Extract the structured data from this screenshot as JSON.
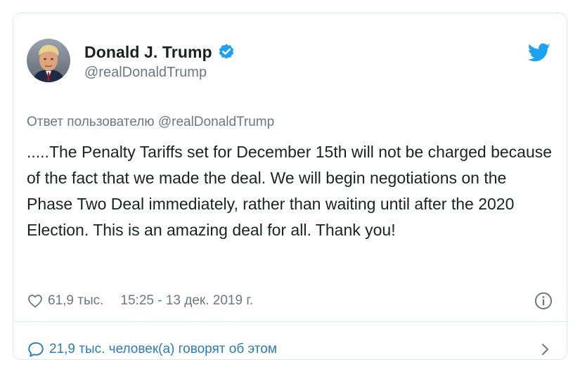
{
  "author": {
    "name": "Donald J. Trump",
    "handle": "@realDonaldTrump",
    "verified": true
  },
  "reply_to": "Ответ пользователю @realDonaldTrump",
  "tweet": {
    "text": ".....The Penalty Tariffs set for December 15th will not be charged because of the fact that we made the deal. We will begin negotiations on the Phase Two Deal immediately, rather than waiting until after the 2020 Election. This is an amazing deal for all. Thank you!"
  },
  "meta": {
    "likes": "61,9 тыс.",
    "timestamp": "15:25 - 13 дек. 2019 г."
  },
  "footer": {
    "discussion": "21,9 тыс. человек(а) говорят об этом"
  },
  "icons": {
    "verified": "verified-badge-icon",
    "brand": "twitter-bird-icon",
    "like": "heart-icon",
    "info": "info-icon",
    "comments": "speech-bubble-icon",
    "more": "chevron-right-icon"
  },
  "colors": {
    "brand_blue": "#1da1f2",
    "link_blue": "#2b7bb9",
    "text": "#1c2022",
    "secondary_text": "#697882",
    "border": "#e1e8ed"
  }
}
